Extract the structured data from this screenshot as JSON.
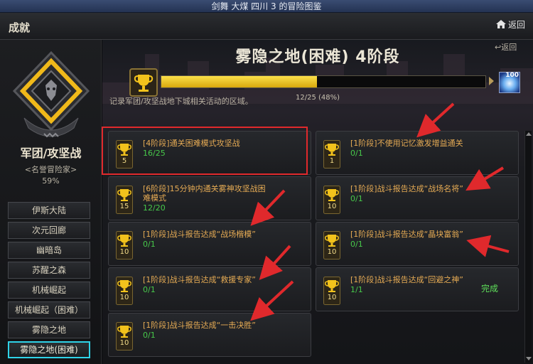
{
  "titlebar": {
    "text": "剑舞 大煤 四川 3 的冒险图鉴"
  },
  "header": {
    "title": "成就",
    "home_label": "返回"
  },
  "sidebar": {
    "category_title": "军团/攻坚战",
    "subtitle": "<名誉冒险家>",
    "percent": "59%",
    "items": [
      {
        "label": "伊斯大陆"
      },
      {
        "label": "次元回廊"
      },
      {
        "label": "幽暗岛"
      },
      {
        "label": "苏醒之森"
      },
      {
        "label": "机械崛起"
      },
      {
        "label": "机械崛起（困难）"
      },
      {
        "label": "雾隐之地"
      },
      {
        "label": "雾隐之地(困难)",
        "active": true
      }
    ]
  },
  "main": {
    "back_label": "返回",
    "stage_title": "雾隐之地(困难) 4阶段",
    "progress": {
      "current": 12,
      "total": 25,
      "fraction": 0.48,
      "text": "12/25 (48%)"
    },
    "reward_count": "100",
    "description": "记录军团/攻坚战地下城相关活动的区域。",
    "achievements": [
      {
        "trophy": "5",
        "name": "[4阶段]通关困难模式攻坚战",
        "count": "16/25",
        "done": ""
      },
      {
        "trophy": "1",
        "name": "[1阶段]不使用记忆激发增益通关",
        "count": "0/1",
        "done": ""
      },
      {
        "trophy": "15",
        "name": "[6阶段]15分钟内通关雾神攻坚战困难模式",
        "count": "12/20",
        "done": ""
      },
      {
        "trophy": "10",
        "name": "[1阶段]战斗报告达成“战场名将”",
        "count": "0/1",
        "done": ""
      },
      {
        "trophy": "10",
        "name": "[1阶段]战斗报告达成“战场楷模”",
        "count": "0/1",
        "done": ""
      },
      {
        "trophy": "10",
        "name": "[1阶段]战斗报告达成“晶块富翁”",
        "count": "0/1",
        "done": ""
      },
      {
        "trophy": "10",
        "name": "[1阶段]战斗报告达成“救援专家”",
        "count": "0/1",
        "done": ""
      },
      {
        "trophy": "10",
        "name": "[1阶段]战斗报告达成“回避之神”",
        "count": "1/1",
        "done": "完成"
      },
      {
        "trophy": "10",
        "name": "[1阶段]战斗报告达成“一击决胜”",
        "count": "0/1",
        "done": ""
      }
    ]
  },
  "colors": {
    "accent_gold": "#f0c419",
    "achievement_name": "#e6ab54",
    "count_green": "#47c94a",
    "active_border": "#2fd3e8",
    "annotation_red": "#e0292c"
  },
  "icons": {
    "trophy": "trophy-icon",
    "home": "home-icon",
    "back": "back-arrow-icon",
    "emblem": "guild-emblem-icon",
    "reward": "reward-item-icon"
  }
}
